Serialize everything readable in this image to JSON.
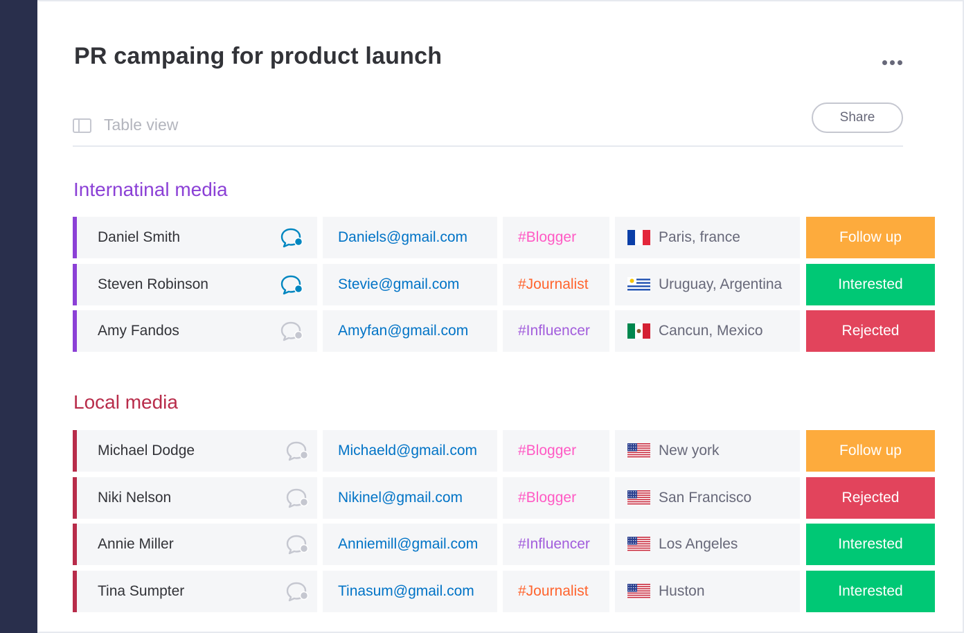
{
  "board": {
    "title": "PR campaing for product launch",
    "view_label": "Table view",
    "share_label": "Share"
  },
  "colors": {
    "sidebar": "#292f4c",
    "international_group": "#8b40d6",
    "local_group": "#b82c4a",
    "email": "#0073c6",
    "follow_up": "#fdab3d",
    "interested": "#00c875",
    "rejected": "#e2445c",
    "tag_blogger": "#ff5ac4",
    "tag_journalist": "#ff642e",
    "tag_influencer": "#a25ddc",
    "chat_active": "#0086c0",
    "chat_inactive": "#c5c7d0"
  },
  "groups": [
    {
      "title": "Internatinal media",
      "rows": [
        {
          "name": "Daniel Smith",
          "chat_icon": "chat-bubble-icon-active",
          "email": "Daniels@gmail.com",
          "tag": "#Blogger",
          "flag_icon": "france-flag-icon",
          "location": "Paris, france",
          "status": "Follow up"
        },
        {
          "name": "Steven Robinson",
          "chat_icon": "chat-bubble-icon-active",
          "email": "Stevie@gmail.com",
          "tag": "#Journalist",
          "flag_icon": "uruguay-flag-icon",
          "location": "Uruguay, Argentina",
          "status": "Interested"
        },
        {
          "name": "Amy Fandos",
          "chat_icon": "chat-bubble-icon",
          "email": "Amyfan@gmail.com",
          "tag": "#Influencer",
          "flag_icon": "mexico-flag-icon",
          "location": "Cancun, Mexico",
          "status": "Rejected"
        }
      ]
    },
    {
      "title": "Local media",
      "rows": [
        {
          "name": "Michael Dodge",
          "chat_icon": "chat-bubble-icon",
          "email": "Michaeld@gmail.com",
          "tag": "#Blogger",
          "flag_icon": "usa-flag-icon",
          "location": "New york",
          "status": "Follow up"
        },
        {
          "name": "Niki Nelson",
          "chat_icon": "chat-bubble-icon",
          "email": "Nikinel@gmail.com",
          "tag": "#Blogger",
          "flag_icon": "usa-flag-icon",
          "location": "San Francisco",
          "status": "Rejected"
        },
        {
          "name": "Annie Miller",
          "chat_icon": "chat-bubble-icon",
          "email": "Anniemill@gmail.com",
          "tag": "#Influencer",
          "flag_icon": "usa-flag-icon",
          "location": "Los Angeles",
          "status": "Interested"
        },
        {
          "name": "Tina Sumpter",
          "chat_icon": "chat-bubble-icon",
          "email": "Tinasum@gmail.com",
          "tag": "#Journalist",
          "flag_icon": "usa-flag-icon",
          "location": "Huston",
          "status": "Interested"
        }
      ]
    }
  ]
}
